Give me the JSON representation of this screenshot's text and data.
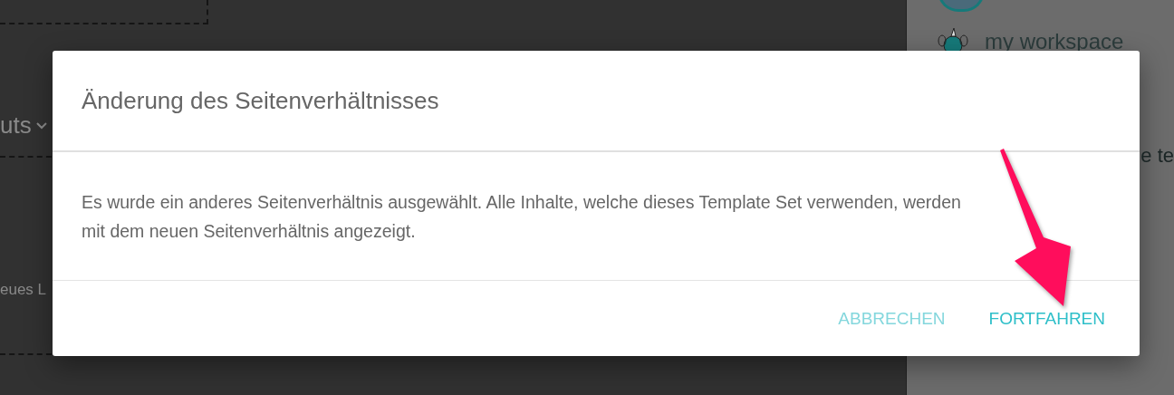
{
  "background": {
    "section_label": "uts",
    "new_item_label": "eues L",
    "workspace_label": "my workspace",
    "side_text": "e te"
  },
  "dialog": {
    "title": "Änderung des Seitenverhältnisses",
    "message": "Es wurde ein anderes Seitenverhältnis ausgewählt. Alle Inhalte, welche dieses Template Set verwenden, werden mit dem neuen Seitenverhältnis angezeigt.",
    "buttons": [
      {
        "label": "ABBRECHEN",
        "kind": "secondary"
      },
      {
        "label": "FORTFAHREN",
        "kind": "primary"
      }
    ]
  }
}
